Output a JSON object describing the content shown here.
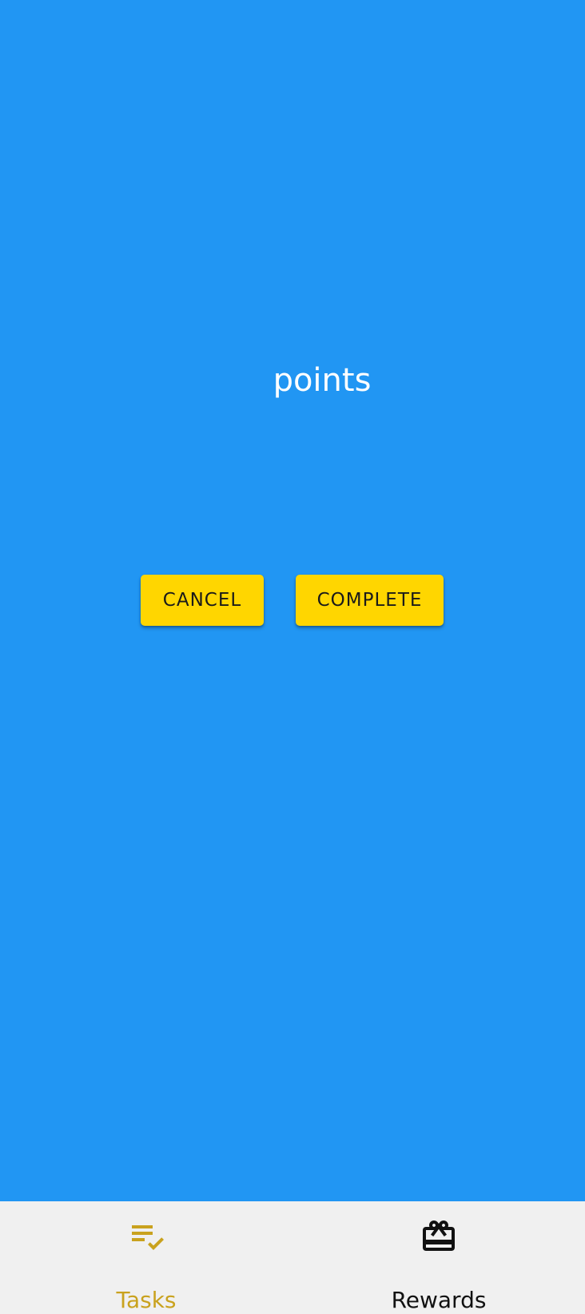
{
  "main": {
    "points_label": "points",
    "cancel_label": "CANCEL",
    "complete_label": "COMPLETE"
  },
  "nav": {
    "items": [
      {
        "label": "Tasks",
        "icon": "playlist-check-icon",
        "active": true
      },
      {
        "label": "Rewards",
        "icon": "gift-card-icon",
        "active": false
      }
    ]
  },
  "colors": {
    "background": "#2196F3",
    "button": "#FFD600",
    "nav_background": "#F0F0F0",
    "active_tab": "#C9A21E",
    "inactive_tab": "#111111"
  }
}
